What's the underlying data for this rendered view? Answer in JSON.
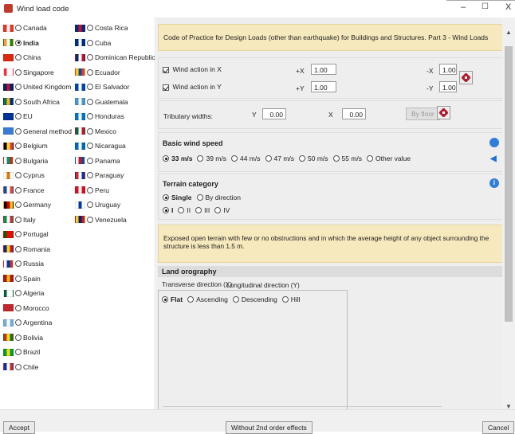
{
  "window": {
    "title": "Wind load code",
    "minimize": "–",
    "maximize": "☐",
    "close": "X"
  },
  "countries_col1": [
    {
      "name": "Canada",
      "selected": false,
      "colors": [
        "#e32",
        "#fff",
        "#e32"
      ]
    },
    {
      "name": "India",
      "selected": true,
      "colors": [
        "#f93",
        "#fff",
        "#128807"
      ]
    },
    {
      "name": "China",
      "selected": false,
      "colors": [
        "#de2910",
        "#de2910",
        "#de2910"
      ]
    },
    {
      "name": "Singapore",
      "selected": false,
      "colors": [
        "#ef3340",
        "#fff",
        "#fff"
      ]
    },
    {
      "name": "United Kingdom",
      "selected": false,
      "colors": [
        "#012169",
        "#c8102e",
        "#012169"
      ]
    },
    {
      "name": "South Africa",
      "selected": false,
      "colors": [
        "#007a4d",
        "#ffb612",
        "#002395"
      ]
    },
    {
      "name": "EU",
      "selected": false,
      "colors": [
        "#039",
        "#039",
        "#039"
      ]
    },
    {
      "name": "General method",
      "selected": false,
      "colors": [
        "#3a7bd5",
        "#3a7bd5",
        "#3a7bd5"
      ]
    },
    {
      "name": "Belgium",
      "selected": false,
      "colors": [
        "#000",
        "#fdda24",
        "#ef3340"
      ]
    },
    {
      "name": "Bulgaria",
      "selected": false,
      "colors": [
        "#fff",
        "#00966e",
        "#d62612"
      ]
    },
    {
      "name": "Cyprus",
      "selected": false,
      "colors": [
        "#fff",
        "#d57800",
        "#fff"
      ]
    },
    {
      "name": "France",
      "selected": false,
      "colors": [
        "#0055a4",
        "#fff",
        "#ef4135"
      ]
    },
    {
      "name": "Germany",
      "selected": false,
      "colors": [
        "#000",
        "#dd0000",
        "#ffce00"
      ]
    },
    {
      "name": "Italy",
      "selected": false,
      "colors": [
        "#009246",
        "#fff",
        "#ce2b37"
      ]
    },
    {
      "name": "Portugal",
      "selected": false,
      "colors": [
        "#006600",
        "#ff0000",
        "#ff0000"
      ]
    },
    {
      "name": "Romania",
      "selected": false,
      "colors": [
        "#002b7f",
        "#fcd116",
        "#ce1126"
      ]
    },
    {
      "name": "Russia",
      "selected": false,
      "colors": [
        "#fff",
        "#0039a6",
        "#d52b1e"
      ]
    },
    {
      "name": "Spain",
      "selected": false,
      "colors": [
        "#aa151b",
        "#f1bf00",
        "#aa151b"
      ]
    },
    {
      "name": "Algeria",
      "selected": false,
      "colors": [
        "#006233",
        "#fff",
        "#fff"
      ]
    },
    {
      "name": "Morocco",
      "selected": false,
      "colors": [
        "#c1272d",
        "#c1272d",
        "#c1272d"
      ]
    },
    {
      "name": "Argentina",
      "selected": false,
      "colors": [
        "#74acdf",
        "#fff",
        "#74acdf"
      ]
    },
    {
      "name": "Bolivia",
      "selected": false,
      "colors": [
        "#d52b1e",
        "#f9e300",
        "#007934"
      ]
    },
    {
      "name": "Brazil",
      "selected": false,
      "colors": [
        "#009c3b",
        "#ffdf00",
        "#009c3b"
      ]
    },
    {
      "name": "Chile",
      "selected": false,
      "colors": [
        "#0039a6",
        "#fff",
        "#d52b1e"
      ]
    }
  ],
  "countries_col2": [
    {
      "name": "Costa Rica",
      "selected": false,
      "colors": [
        "#002b7f",
        "#ce1126",
        "#002b7f"
      ]
    },
    {
      "name": "Cuba",
      "selected": false,
      "colors": [
        "#002a8f",
        "#fff",
        "#002a8f"
      ]
    },
    {
      "name": "Dominican Republic",
      "selected": false,
      "colors": [
        "#002d62",
        "#fff",
        "#ce1126"
      ]
    },
    {
      "name": "Ecuador",
      "selected": false,
      "colors": [
        "#ffd100",
        "#034ea2",
        "#ef3340"
      ]
    },
    {
      "name": "El Salvador",
      "selected": false,
      "colors": [
        "#0047ab",
        "#fff",
        "#0047ab"
      ]
    },
    {
      "name": "Guatemala",
      "selected": false,
      "colors": [
        "#4997d0",
        "#fff",
        "#4997d0"
      ]
    },
    {
      "name": "Honduras",
      "selected": false,
      "colors": [
        "#0073cf",
        "#fff",
        "#0073cf"
      ]
    },
    {
      "name": "Mexico",
      "selected": false,
      "colors": [
        "#006847",
        "#fff",
        "#ce1126"
      ]
    },
    {
      "name": "Nicaragua",
      "selected": false,
      "colors": [
        "#0067c6",
        "#fff",
        "#0067c6"
      ]
    },
    {
      "name": "Panama",
      "selected": false,
      "colors": [
        "#fff",
        "#d21034",
        "#005293"
      ]
    },
    {
      "name": "Paraguay",
      "selected": false,
      "colors": [
        "#d52b1e",
        "#fff",
        "#0038a8"
      ]
    },
    {
      "name": "Peru",
      "selected": false,
      "colors": [
        "#d91023",
        "#fff",
        "#d91023"
      ]
    },
    {
      "name": "Uruguay",
      "selected": false,
      "colors": [
        "#fff",
        "#0038a8",
        "#fff"
      ]
    },
    {
      "name": "Venezuela",
      "selected": false,
      "colors": [
        "#fcd116",
        "#00247d",
        "#cf142b"
      ]
    }
  ],
  "code_description": "Code of Practice for Design Loads (other than earthquake) for Buildings and Structures. Part 3 - Wind Loads",
  "wind_action": {
    "x_label": "Wind action in X",
    "x_checked": true,
    "y_label": "Wind action in Y",
    "y_checked": true,
    "plus_x_label": "+X",
    "plus_x_value": "1.00",
    "minus_x_label": "-X",
    "minus_x_value": "1.00",
    "plus_y_label": "+Y",
    "plus_y_value": "1.00",
    "minus_y_label": "-Y",
    "minus_y_value": "1.00"
  },
  "tributary": {
    "label": "Tributary widths:",
    "y_label": "Y",
    "y_value": "0.00",
    "x_label": "X",
    "x_value": "0.00",
    "by_floor": "By floor"
  },
  "basic_wind_speed": {
    "title": "Basic wind speed",
    "options": [
      {
        "label": "33 m/s",
        "selected": true
      },
      {
        "label": "39 m/s",
        "selected": false
      },
      {
        "label": "44 m/s",
        "selected": false
      },
      {
        "label": "47 m/s",
        "selected": false
      },
      {
        "label": "50 m/s",
        "selected": false
      },
      {
        "label": "55 m/s",
        "selected": false
      },
      {
        "label": "Other value",
        "selected": false
      }
    ]
  },
  "terrain": {
    "title": "Terrain category",
    "mode": [
      {
        "label": "Single",
        "selected": true
      },
      {
        "label": "By direction",
        "selected": false
      }
    ],
    "categories": [
      {
        "label": "I",
        "selected": true
      },
      {
        "label": "II",
        "selected": false
      },
      {
        "label": "III",
        "selected": false
      },
      {
        "label": "IV",
        "selected": false
      }
    ],
    "description": "Exposed open terrain with few or no obstructions and in which the average height of any object surrounding the structure is less than 1.5 m."
  },
  "orography": {
    "title": "Land orography",
    "tabs": [
      "Transverse direction (X)",
      "Longitudinal direction (Y)"
    ],
    "options": [
      {
        "label": "Flat",
        "selected": true
      },
      {
        "label": "Ascending",
        "selected": false
      },
      {
        "label": "Descending",
        "selected": false
      },
      {
        "label": "Hill",
        "selected": false
      }
    ]
  },
  "buttons": {
    "accept": "Accept",
    "second_order": "Without 2nd order effects",
    "cancel": "Cancel"
  },
  "colors": {
    "yellow_panel": "#f6e9bd",
    "panel_bg": "#eeeeee",
    "accent_blue": "#1e6fd0"
  }
}
